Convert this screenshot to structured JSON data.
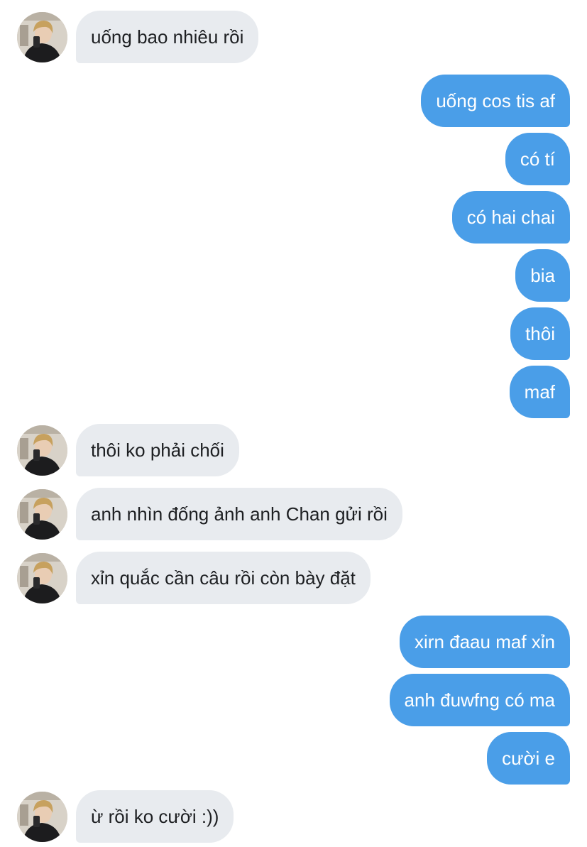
{
  "conversation": {
    "messages": [
      {
        "side": "in",
        "text": "uống bao nhiêu rồi"
      },
      {
        "side": "out",
        "text": "uống cos tis af"
      },
      {
        "side": "out",
        "text": "có tí"
      },
      {
        "side": "out",
        "text": "có hai chai"
      },
      {
        "side": "out",
        "text": "bia"
      },
      {
        "side": "out",
        "text": "thôi"
      },
      {
        "side": "out",
        "text": "maf"
      },
      {
        "side": "in",
        "text": "thôi ko phải chối"
      },
      {
        "side": "in",
        "text": "anh nhìn đống ảnh anh Chan gửi rồi"
      },
      {
        "side": "in",
        "text": "xỉn quắc cần câu rồi còn bày đặt"
      },
      {
        "side": "out",
        "text": "xirn đaau maf xỉn"
      },
      {
        "side": "out",
        "text": "anh đuwfng có ma"
      },
      {
        "side": "out",
        "text": "cười e"
      },
      {
        "side": "in",
        "text": "ừ rồi ko cười :))"
      }
    ]
  },
  "theme": {
    "incoming_bubble_color": "#e8ebef",
    "outgoing_bubble_color": "#4a9ee8",
    "outgoing_text_color": "#ffffff"
  }
}
